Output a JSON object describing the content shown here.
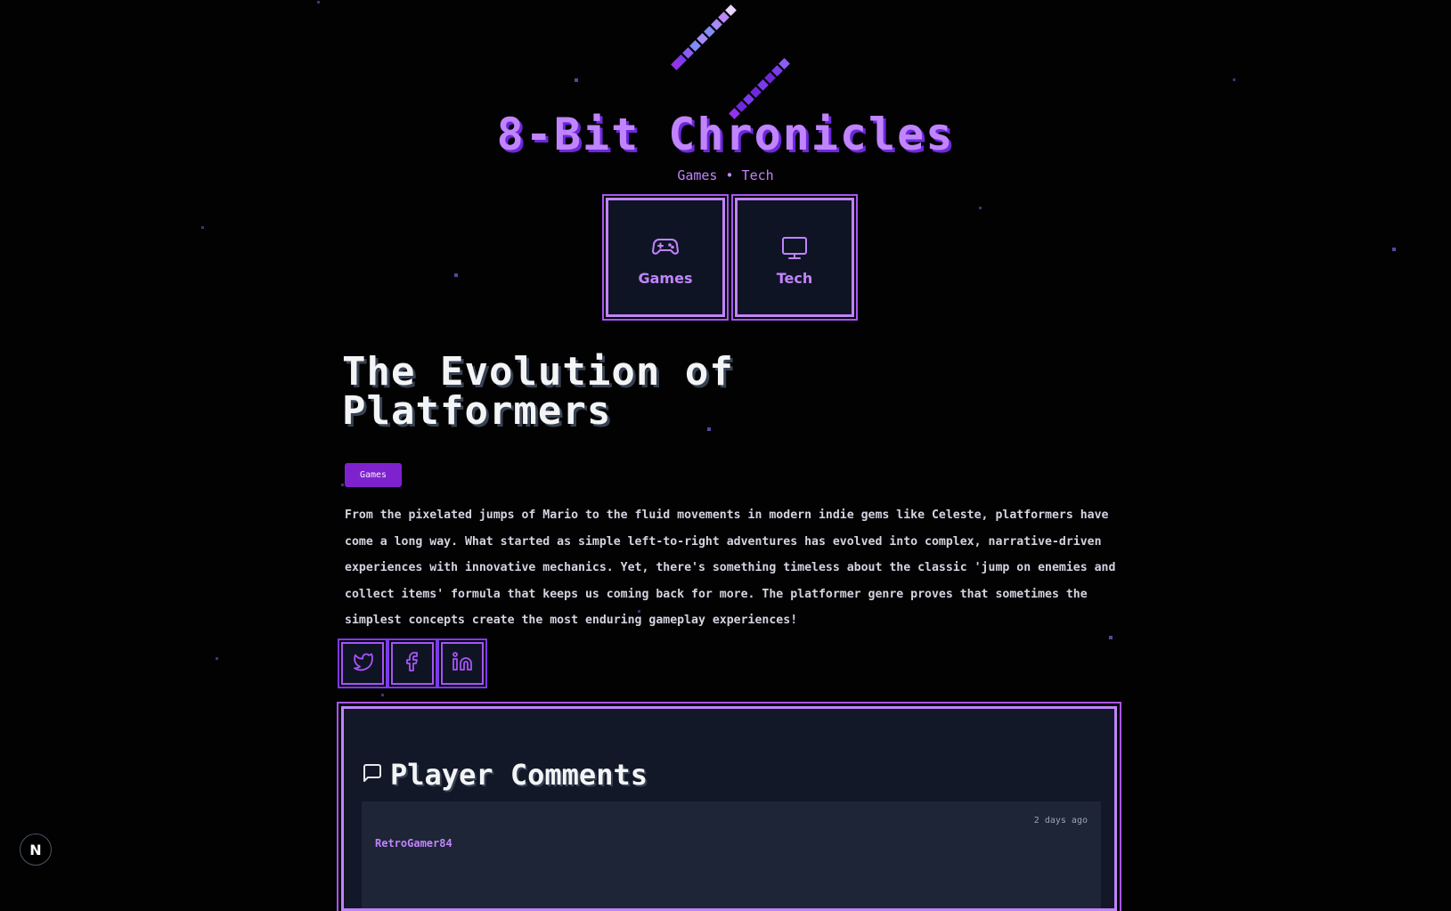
{
  "site": {
    "title": "8-Bit Chronicles",
    "subtitle": "Games • Tech"
  },
  "categories": [
    {
      "label": "Games",
      "icon": "gamepad-icon"
    },
    {
      "label": "Tech",
      "icon": "monitor-icon"
    }
  ],
  "post": {
    "title": "The Evolution of Platformers",
    "tag": "Games",
    "body": "From the pixelated jumps of Mario to the fluid movements in modern indie gems like Celeste, platformers have come a long way. What started as simple left-to-right adventures has evolved into complex, narrative-driven experiences with innovative mechanics. Yet, there's something timeless about the classic 'jump on enemies and collect items' formula that keeps us coming back for more. The platformer genre proves that sometimes the simplest concepts create the most enduring gameplay experiences!"
  },
  "share": [
    {
      "icon": "twitter-icon"
    },
    {
      "icon": "facebook-icon"
    },
    {
      "icon": "linkedin-icon"
    }
  ],
  "comments": {
    "title": "Player Comments",
    "items": [
      {
        "author": "RetroGamer84",
        "time": "2 days ago"
      }
    ]
  },
  "badge": "N",
  "colors": {
    "background": "#020203",
    "accent": "#c084fc",
    "accent_dark": "#7e22ce",
    "panel": "#121828",
    "comment_card": "#1e2537"
  }
}
